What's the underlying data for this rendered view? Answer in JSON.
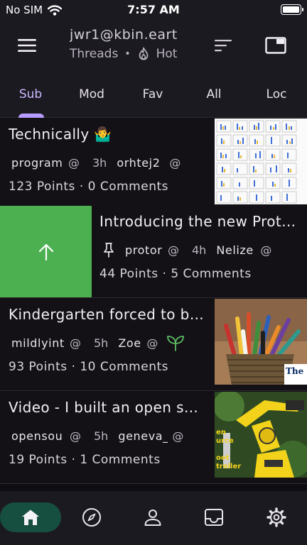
{
  "status": {
    "carrier": "No SIM",
    "time": "7:57 AM"
  },
  "header": {
    "account": "jwr1@kbin.eart",
    "view": "Threads",
    "separator": "•",
    "sort": "Hot"
  },
  "tabs": [
    {
      "label": "Sub",
      "active": true
    },
    {
      "label": "Mod",
      "active": false
    },
    {
      "label": "Fav",
      "active": false
    },
    {
      "label": "All",
      "active": false
    },
    {
      "label": "Loc",
      "active": false
    }
  ],
  "posts": [
    {
      "title": "Technically 🤷‍♂️",
      "community": "program",
      "at1": "@",
      "age": "3h",
      "author": "orhtej2",
      "at2": "@",
      "counts": "123 Points · 0 Comments",
      "thumbnail": "plot-grid"
    },
    {
      "title": "Introducing the new Prot…",
      "community": "protor",
      "at1": "@",
      "age": "4h",
      "author": "Nelize",
      "at2": "@",
      "counts": "44 Points · 5 Comments",
      "pinned": true,
      "swipe_action": "upvote",
      "swipe_color": "#4caf50"
    },
    {
      "title": "Kindergarten forced to b…",
      "community": "mildlyint",
      "at1": "@",
      "age": "5h",
      "author": "Zoe",
      "at2": "@",
      "counts": "93 Points · 10 Comments",
      "badge": "sprout-icon",
      "thumbnail": "pencils",
      "thumb_text": "The Gua"
    },
    {
      "title": "Video - I built an open s…",
      "community": "opensou",
      "at1": "@",
      "age": "5h",
      "author": "geneva_",
      "at2": "@",
      "counts": "19 Points · 1 Comments",
      "thumbnail": "robot-arm",
      "thumb_text": [
        "en",
        "urce",
        "oot",
        "troller"
      ]
    }
  ],
  "nav": [
    {
      "name": "home",
      "icon": "home-icon",
      "active": true
    },
    {
      "name": "explore",
      "icon": "compass-icon",
      "active": false
    },
    {
      "name": "profile",
      "icon": "person-icon",
      "active": false
    },
    {
      "name": "inbox",
      "icon": "inbox-icon",
      "active": false
    },
    {
      "name": "settings",
      "icon": "gear-icon",
      "active": false
    }
  ],
  "colors": {
    "accent": "#b79cff",
    "upvote": "#4caf50",
    "nav_active": "#164f3f",
    "badge": "#5dbb63"
  }
}
